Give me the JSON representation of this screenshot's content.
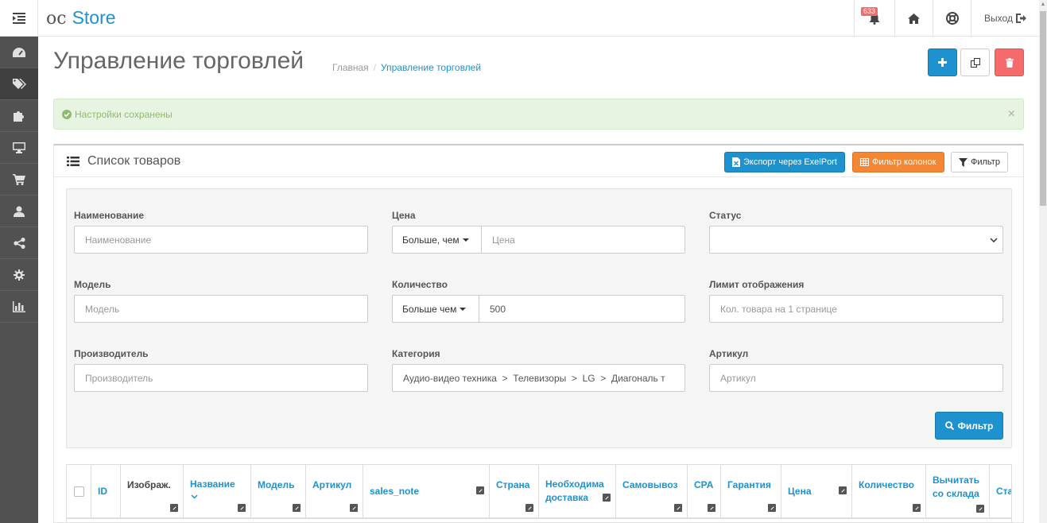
{
  "header": {
    "logo_prefix": "oc",
    "logo_brand": "Store",
    "notifications_count": "633",
    "logout_label": "Выход"
  },
  "page": {
    "title": "Управление торговлей",
    "breadcrumb": {
      "home": "Главная",
      "current": "Управление торговлей"
    }
  },
  "alert": {
    "message": "Настройки сохранены",
    "close": "×"
  },
  "panel": {
    "title": "Список товаров",
    "export_label": "Экспорт через ExelPort",
    "columns_filter_label": "Фильтр колонок",
    "filter_label": "Фильтр"
  },
  "filters": {
    "name": {
      "label": "Наименование",
      "placeholder": "Наименование"
    },
    "price": {
      "label": "Цена",
      "operator": "Больше, чем",
      "placeholder": "Цена"
    },
    "status": {
      "label": "Статус",
      "value": ""
    },
    "model": {
      "label": "Модель",
      "placeholder": "Модель"
    },
    "quantity": {
      "label": "Количество",
      "operator": "Больше чем",
      "value": "500"
    },
    "limit": {
      "label": "Лимит отображения",
      "placeholder": "Кол. товара на 1 странице"
    },
    "manufacturer": {
      "label": "Производитель",
      "placeholder": "Производитель"
    },
    "category": {
      "label": "Категория",
      "value": "Аудио-видео техника  >  Телевизоры  >  LG  >  Диагональ т"
    },
    "sku": {
      "label": "Артикул",
      "placeholder": "Артикул"
    },
    "submit_label": "Фильтр"
  },
  "table": {
    "columns": [
      "ID",
      "Изображ.",
      "Название",
      "Модель",
      "Артикул",
      "sales_note",
      "Страна",
      "Необходима доставка",
      "Самовывоз",
      "CPA",
      "Гарантия",
      "Цена",
      "Количество",
      "Вычитать со склада",
      "Ста"
    ]
  },
  "colors": {
    "accent": "#1e91cf",
    "orange": "#f38733",
    "danger": "#f56b6b",
    "sidebar": "#515151",
    "success_bg": "#e8f4e2"
  }
}
